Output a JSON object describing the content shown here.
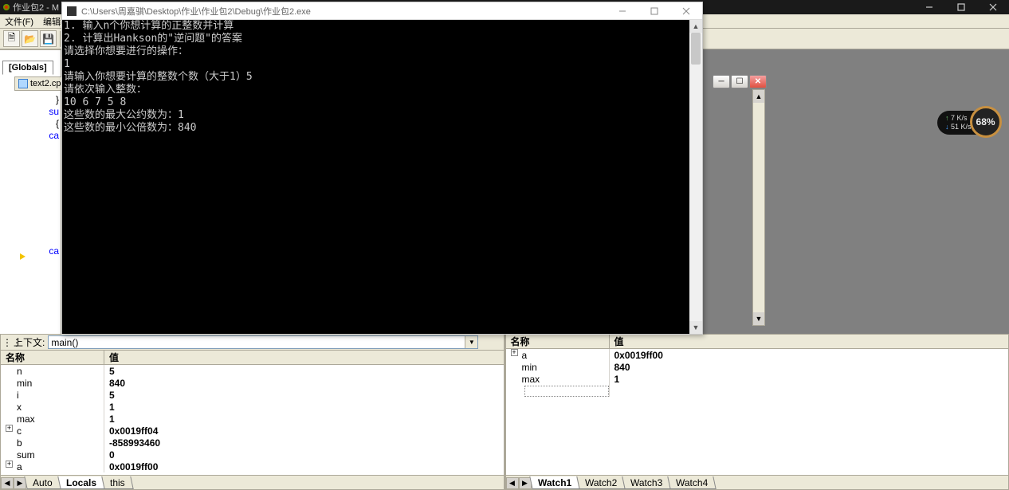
{
  "outer": {
    "title": "作业包2 - M"
  },
  "ide_menu": {
    "file": "文件(F)",
    "edit": "编辑("
  },
  "globals_tab": "[Globals]",
  "file_tab": {
    "name": "text2.cp"
  },
  "gutter_code": {
    "l1": "}",
    "l2": "su",
    "l3": "{",
    "l4": "ca",
    "l5": "ca"
  },
  "console": {
    "title": "C:\\Users\\周嘉骐\\Desktop\\作业\\作业包2\\Debug\\作业包2.exe",
    "lines": [
      "1. 输入n个你想计算的正整数并计算",
      "2. 计算出Hankson的\"逆问题\"的答案",
      "请选择你想要进行的操作：",
      "1",
      "请输入你想要计算的整数个数（大于1）5",
      "请依次输入整数：",
      "10 6 7 5 8",
      "这些数的最大公约数为：1",
      "这些数的最小公倍数为：840"
    ]
  },
  "context": {
    "label": "上下文:",
    "value": "main()"
  },
  "locals": {
    "header_name": "名称",
    "header_value": "值",
    "rows": [
      {
        "name": "n",
        "value": "5",
        "expand": false
      },
      {
        "name": "min",
        "value": "840",
        "expand": false
      },
      {
        "name": "i",
        "value": "5",
        "expand": false
      },
      {
        "name": "x",
        "value": "1",
        "expand": false
      },
      {
        "name": "max",
        "value": "1",
        "expand": false
      },
      {
        "name": "c",
        "value": "0x0019ff04",
        "expand": true
      },
      {
        "name": "b",
        "value": "-858993460",
        "expand": false
      },
      {
        "name": "sum",
        "value": "0",
        "expand": false
      },
      {
        "name": "a",
        "value": "0x0019ff00",
        "expand": true
      }
    ],
    "tabs": {
      "auto": "Auto",
      "locals": "Locals",
      "this": "this"
    }
  },
  "watch": {
    "header_name": "名称",
    "header_value": "值",
    "rows": [
      {
        "name": "a",
        "value": "0x0019ff00",
        "expand": true
      },
      {
        "name": "min",
        "value": "840",
        "expand": false
      },
      {
        "name": "max",
        "value": "1",
        "expand": false
      }
    ],
    "tabs": {
      "w1": "Watch1",
      "w2": "Watch2",
      "w3": "Watch3",
      "w4": "Watch4"
    }
  },
  "hwmon": {
    "up": "7 K/s",
    "down": "51 K/s",
    "gauge": "68%"
  },
  "classic_controls": {
    "min": "─",
    "max": "☐",
    "close": "✕"
  }
}
